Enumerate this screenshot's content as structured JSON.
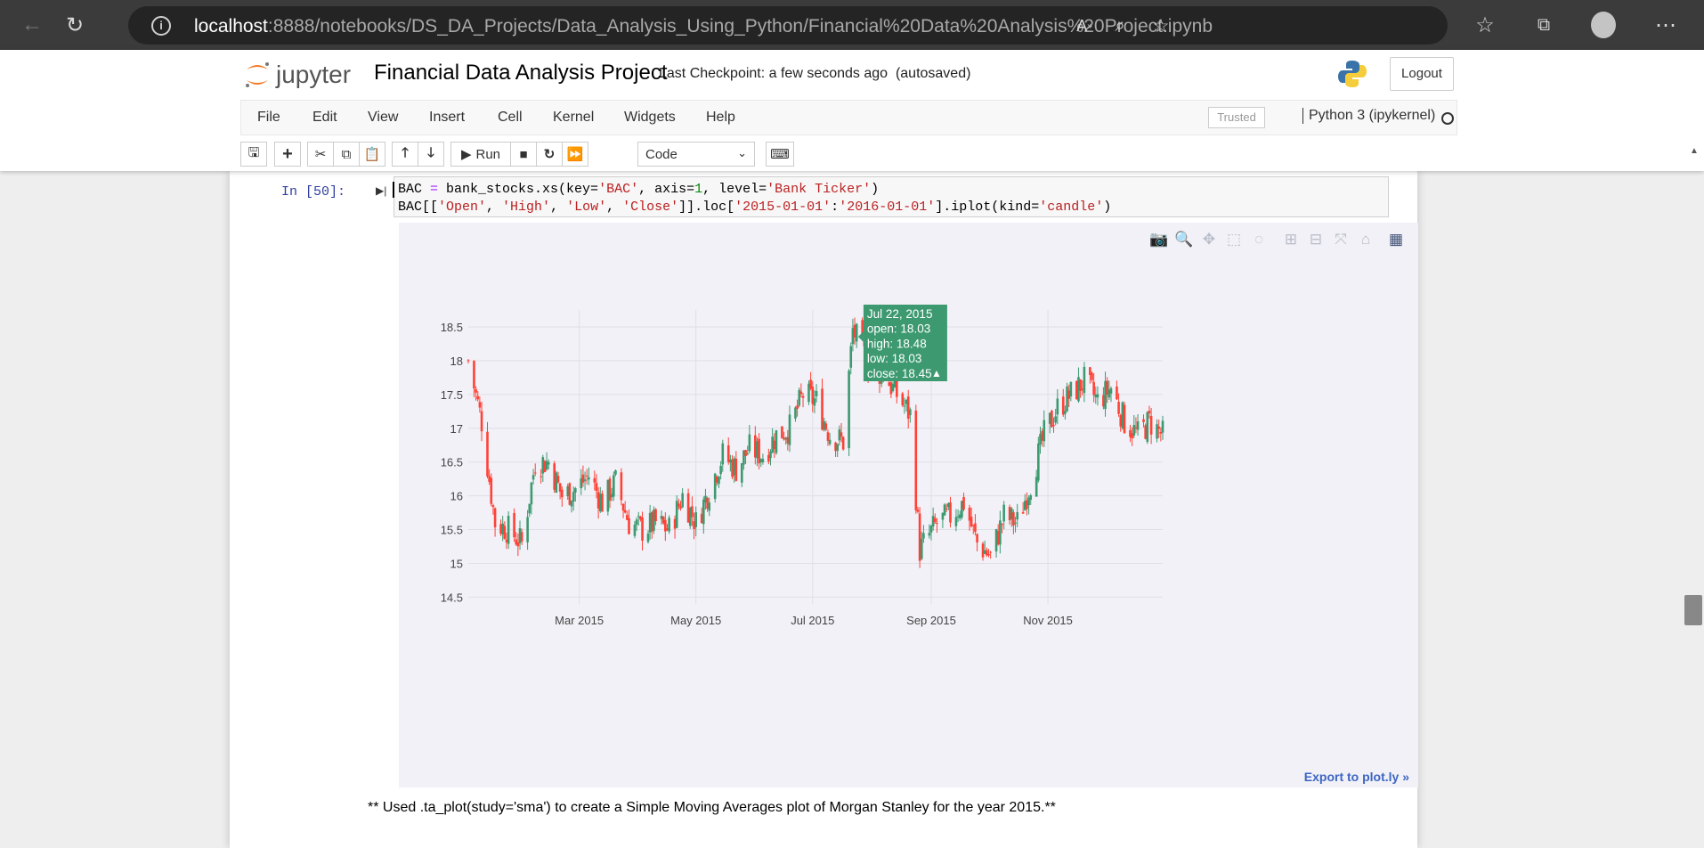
{
  "browser": {
    "url_host": "localhost",
    "url_path": ":8888/notebooks/DS_DA_Projects/Data_Analysis_Using_Python/Financial%20Data%20Analysis%20Project.ipynb",
    "info_icon": "i"
  },
  "header": {
    "logo_text": "jupyter",
    "title": "Financial Data Analysis Project",
    "checkpoint": "Last Checkpoint: a few seconds ago",
    "autosave": "(autosaved)",
    "logout": "Logout"
  },
  "menu": {
    "items": [
      "File",
      "Edit",
      "View",
      "Insert",
      "Cell",
      "Kernel",
      "Widgets",
      "Help"
    ],
    "trusted": "Trusted",
    "kernel": "Python 3 (ipykernel)"
  },
  "toolbar": {
    "run_label": "Run",
    "cell_type": "Code"
  },
  "cell": {
    "prompt": "In [50]:",
    "line1_parts": [
      "BAC ",
      "=",
      " bank_stocks.xs(key=",
      "'BAC'",
      ", axis=",
      "1",
      ", level=",
      "'Bank Ticker'",
      ")"
    ],
    "line2_parts": [
      "BAC[[",
      "'Open'",
      ", ",
      "'High'",
      ", ",
      "'Low'",
      ", ",
      "'Close'",
      "]].loc[",
      "'2015-01-01'",
      ":",
      "'2016-01-01'",
      "].iplot(kind=",
      "'candle'",
      ")"
    ]
  },
  "plot_ui": {
    "export": "Export to plot.ly »"
  },
  "markdown": {
    "text": "** Used .ta_plot(study='sma') to create a Simple Moving Averages plot of Morgan Stanley for the year 2015.**"
  },
  "chart_data": {
    "type": "candlestick",
    "y_ticks": [
      "18.5",
      "18",
      "17.5",
      "17",
      "16.5",
      "16",
      "15.5",
      "15",
      "14.5"
    ],
    "y_tick_values": [
      18.5,
      18,
      17.5,
      17,
      16.5,
      16,
      15.5,
      15,
      14.5
    ],
    "ylim": [
      14.4,
      18.75
    ],
    "x_ticks": [
      "Mar 2015",
      "May 2015",
      "Jul 2015",
      "Sep 2015",
      "Nov 2015"
    ],
    "x_tick_values": [
      "2015-03-01",
      "2015-05-01",
      "2015-07-01",
      "2015-09-01",
      "2015-11-01"
    ],
    "x_range": [
      "2015-01-02",
      "2015-12-31"
    ],
    "increasing_color": "#3d9970",
    "decreasing_color": "#ff4136",
    "tooltip": {
      "date": "Jul 22, 2015",
      "open": "open: 18.03",
      "high": "high: 18.48",
      "low": "low: 18.03",
      "close": "close: 18.45",
      "arrow": "▲",
      "color": "#3d9970"
    },
    "close_anchors": [
      [
        "2015-01-02",
        18.0
      ],
      [
        "2015-01-09",
        17.1
      ],
      [
        "2015-01-16",
        15.6
      ],
      [
        "2015-01-23",
        15.5
      ],
      [
        "2015-01-30",
        15.3
      ],
      [
        "2015-02-06",
        16.5
      ],
      [
        "2015-02-13",
        16.5
      ],
      [
        "2015-02-20",
        16.0
      ],
      [
        "2015-02-27",
        16.1
      ],
      [
        "2015-03-06",
        16.3
      ],
      [
        "2015-03-13",
        15.9
      ],
      [
        "2015-03-20",
        16.2
      ],
      [
        "2015-03-27",
        15.6
      ],
      [
        "2015-04-03",
        15.5
      ],
      [
        "2015-04-10",
        15.6
      ],
      [
        "2015-04-17",
        15.5
      ],
      [
        "2015-04-24",
        16.0
      ],
      [
        "2015-05-01",
        15.6
      ],
      [
        "2015-05-08",
        16.1
      ],
      [
        "2015-05-15",
        16.6
      ],
      [
        "2015-05-22",
        16.4
      ],
      [
        "2015-05-29",
        16.7
      ],
      [
        "2015-06-05",
        16.6
      ],
      [
        "2015-06-12",
        16.9
      ],
      [
        "2015-06-19",
        17.0
      ],
      [
        "2015-06-26",
        17.5
      ],
      [
        "2015-07-03",
        17.4
      ],
      [
        "2015-07-10",
        16.9
      ],
      [
        "2015-07-17",
        16.8
      ],
      [
        "2015-07-22",
        18.45
      ],
      [
        "2015-07-31",
        17.9
      ],
      [
        "2015-08-07",
        17.8
      ],
      [
        "2015-08-14",
        17.5
      ],
      [
        "2015-08-21",
        17.2
      ],
      [
        "2015-08-26",
        15.2
      ],
      [
        "2015-09-04",
        15.6
      ],
      [
        "2015-09-11",
        15.7
      ],
      [
        "2015-09-18",
        15.9
      ],
      [
        "2015-09-25",
        15.3
      ],
      [
        "2015-10-02",
        15.1
      ],
      [
        "2015-10-09",
        15.7
      ],
      [
        "2015-10-16",
        15.6
      ],
      [
        "2015-10-23",
        16.2
      ],
      [
        "2015-10-30",
        16.9
      ],
      [
        "2015-11-06",
        17.3
      ],
      [
        "2015-11-13",
        17.5
      ],
      [
        "2015-11-20",
        17.7
      ],
      [
        "2015-11-27",
        17.4
      ],
      [
        "2015-12-04",
        17.6
      ],
      [
        "2015-12-11",
        17.1
      ],
      [
        "2015-12-18",
        16.9
      ],
      [
        "2015-12-24",
        17.1
      ],
      [
        "2015-12-31",
        16.9
      ]
    ]
  }
}
